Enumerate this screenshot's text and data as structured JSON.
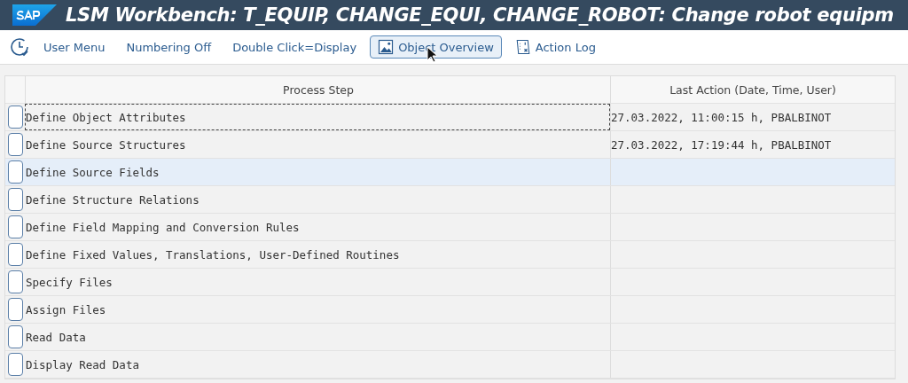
{
  "window": {
    "title": "LSM Workbench: T_EQUIP, CHANGE_EQUI, CHANGE_ROBOT: Change robot equipm"
  },
  "toolbar": [
    {
      "kind": "history"
    },
    {
      "kind": "text",
      "label": "User Menu",
      "active": false
    },
    {
      "kind": "text",
      "label": "Numbering Off",
      "active": false
    },
    {
      "kind": "text",
      "label": "Double Click=Display",
      "active": false
    },
    {
      "kind": "image",
      "label": "Object Overview",
      "active": true
    },
    {
      "kind": "log",
      "label": "Action Log",
      "active": false
    }
  ],
  "table": {
    "columns": [
      "Process Step",
      "Last Action (Date, Time, User)"
    ],
    "rows": [
      {
        "cells": [
          "Define Object Attributes",
          "27.03.2022, 11:00:15 h, PBALBINOT"
        ],
        "selected": false,
        "focused": true
      },
      {
        "cells": [
          "Define Source Structures",
          "27.03.2022, 17:19:44 h, PBALBINOT"
        ],
        "selected": false,
        "focused": false
      },
      {
        "cells": [
          "Define Source Fields",
          ""
        ],
        "selected": true,
        "focused": false
      },
      {
        "cells": [
          "Define Structure Relations",
          ""
        ],
        "selected": false,
        "focused": false
      },
      {
        "cells": [
          "Define Field Mapping and Conversion Rules",
          ""
        ],
        "selected": false,
        "focused": false
      },
      {
        "cells": [
          "Define Fixed Values, Translations, User-Defined Routines",
          ""
        ],
        "selected": false,
        "focused": false
      },
      {
        "cells": [
          "Specify Files",
          ""
        ],
        "selected": false,
        "focused": false
      },
      {
        "cells": [
          "Assign Files",
          ""
        ],
        "selected": false,
        "focused": false
      },
      {
        "cells": [
          "Read Data",
          ""
        ],
        "selected": false,
        "focused": false
      },
      {
        "cells": [
          "Display Read Data",
          ""
        ],
        "selected": false,
        "focused": false
      }
    ]
  }
}
